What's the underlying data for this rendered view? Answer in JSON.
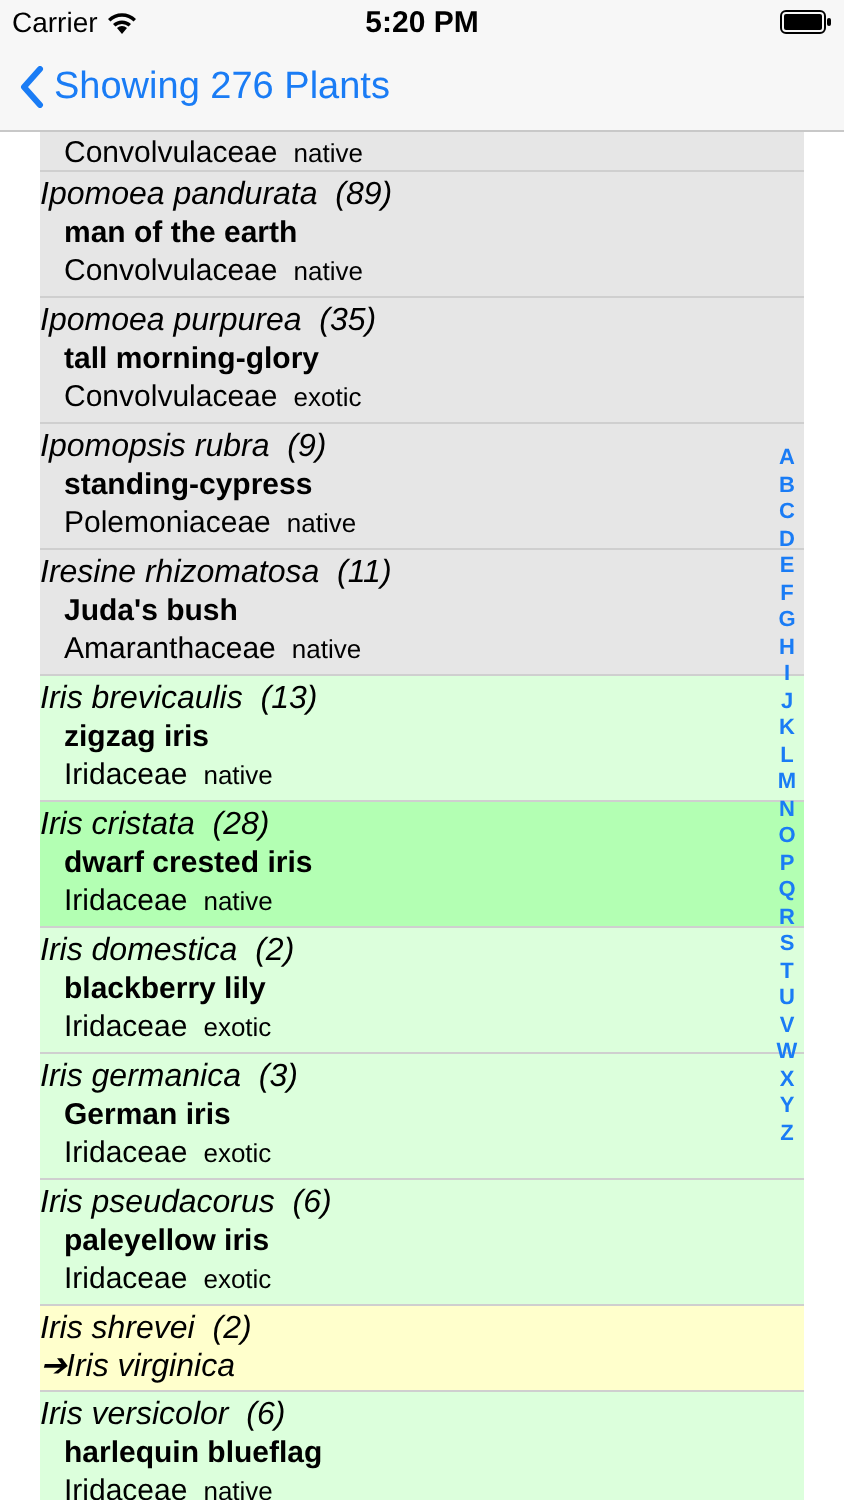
{
  "status_bar": {
    "carrier": "Carrier",
    "time": "5:20 PM"
  },
  "nav": {
    "back_label": "Showing 276 Plants"
  },
  "rows": [
    {
      "kind": "plant",
      "family": "Convolvulaceae",
      "status": "native",
      "color": "#e6e6e6"
    },
    {
      "kind": "plant",
      "species": "Ipomoea pandurata",
      "count": "(89)",
      "common": "man of the earth",
      "family": "Convolvulaceae",
      "status": "native",
      "color": "#e6e6e6"
    },
    {
      "kind": "plant",
      "species": "Ipomoea purpurea",
      "count": "(35)",
      "common": "tall morning-glory",
      "family": "Convolvulaceae",
      "status": "exotic",
      "color": "#e6e6e6"
    },
    {
      "kind": "plant",
      "species": "Ipomopsis rubra",
      "count": "(9)",
      "common": "standing-cypress",
      "family": "Polemoniaceae",
      "status": "native",
      "color": "#e6e6e6"
    },
    {
      "kind": "plant",
      "species": "Iresine rhizomatosa",
      "count": "(11)",
      "common": "Juda's bush",
      "family": "Amaranthaceae",
      "status": "native",
      "color": "#e6e6e6"
    },
    {
      "kind": "plant",
      "species": "Iris brevicaulis",
      "count": "(13)",
      "common": "zigzag iris",
      "family": "Iridaceae",
      "status": "native",
      "color": "#dcffdc"
    },
    {
      "kind": "plant",
      "species": "Iris cristata",
      "count": "(28)",
      "common": "dwarf crested iris",
      "family": "Iridaceae",
      "status": "native",
      "color": "#b3ffb3"
    },
    {
      "kind": "plant",
      "species": "Iris domestica",
      "count": "(2)",
      "common": "blackberry lily",
      "family": "Iridaceae",
      "status": "exotic",
      "color": "#dcffdc"
    },
    {
      "kind": "plant",
      "species": "Iris germanica",
      "count": "(3)",
      "common": "German iris",
      "family": "Iridaceae",
      "status": "exotic",
      "color": "#dcffdc"
    },
    {
      "kind": "plant",
      "species": "Iris pseudacorus",
      "count": "(6)",
      "common": "paleyellow iris",
      "family": "Iridaceae",
      "status": "exotic",
      "color": "#dcffdc"
    },
    {
      "kind": "synonym",
      "species": "Iris shrevei",
      "count": "(2)",
      "target": "➔Iris virginica",
      "color": "#ffffcc"
    },
    {
      "kind": "plant",
      "species": "Iris versicolor",
      "count": "(6)",
      "common": "harlequin blueflag",
      "family": "Iridaceae",
      "status": "native",
      "color": "#dcffdc"
    }
  ],
  "index": [
    "A",
    "B",
    "C",
    "D",
    "E",
    "F",
    "G",
    "H",
    "I",
    "J",
    "K",
    "L",
    "M",
    "N",
    "O",
    "P",
    "Q",
    "R",
    "S",
    "T",
    "U",
    "V",
    "W",
    "X",
    "Y",
    "Z"
  ]
}
